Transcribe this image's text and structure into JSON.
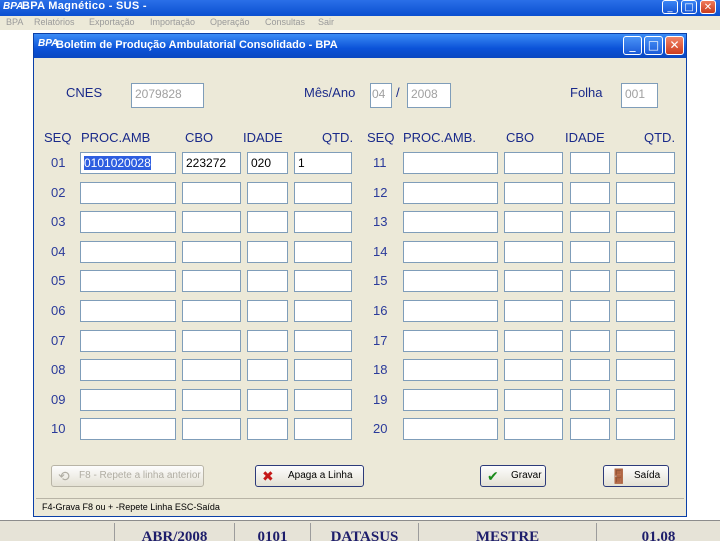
{
  "app": {
    "title": "BPA Magnético - SUS -",
    "logo": "BPA",
    "minimize": "_",
    "maximize": "□",
    "close": "✕"
  },
  "menu": [
    "BPA",
    "Relatórios",
    "Exportação",
    "Importação",
    "Operação",
    "Consultas",
    "Sair"
  ],
  "statusbar": [
    "ABR/2008",
    "0101",
    "DATASUS",
    "MESTRE",
    "01.08"
  ],
  "dialog": {
    "logo": "BPA",
    "title": "Boletim de Produção Ambulatorial Consolidado - BPA",
    "minimize": "_",
    "maximize": "□",
    "close": "✕",
    "cnes_label": "CNES",
    "cnes_value": "2079828",
    "mesano_label": "Mês/Ano",
    "mes_value": "04",
    "separator": "/",
    "ano_value": "2008",
    "folha_label": "Folha",
    "folha_value": "001",
    "headers_left": [
      "SEQ",
      "PROC.AMB",
      "CBO",
      "IDADE",
      "QTD."
    ],
    "headers_right": [
      "SEQ",
      "PROC.AMB.",
      "CBO",
      "IDADE",
      "QTD."
    ],
    "rows_left": [
      {
        "seq": "01",
        "proc": "0101020028",
        "cbo": "223272",
        "idade": "020",
        "qtd": "1"
      },
      {
        "seq": "02",
        "proc": "",
        "cbo": "",
        "idade": "",
        "qtd": ""
      },
      {
        "seq": "03",
        "proc": "",
        "cbo": "",
        "idade": "",
        "qtd": ""
      },
      {
        "seq": "04",
        "proc": "",
        "cbo": "",
        "idade": "",
        "qtd": ""
      },
      {
        "seq": "05",
        "proc": "",
        "cbo": "",
        "idade": "",
        "qtd": ""
      },
      {
        "seq": "06",
        "proc": "",
        "cbo": "",
        "idade": "",
        "qtd": ""
      },
      {
        "seq": "07",
        "proc": "",
        "cbo": "",
        "idade": "",
        "qtd": ""
      },
      {
        "seq": "08",
        "proc": "",
        "cbo": "",
        "idade": "",
        "qtd": ""
      },
      {
        "seq": "09",
        "proc": "",
        "cbo": "",
        "idade": "",
        "qtd": ""
      },
      {
        "seq": "10",
        "proc": "",
        "cbo": "",
        "idade": "",
        "qtd": ""
      }
    ],
    "rows_right": [
      {
        "seq": "11"
      },
      {
        "seq": "12"
      },
      {
        "seq": "13"
      },
      {
        "seq": "14"
      },
      {
        "seq": "15"
      },
      {
        "seq": "16"
      },
      {
        "seq": "17"
      },
      {
        "seq": "18"
      },
      {
        "seq": "19"
      },
      {
        "seq": "20"
      }
    ],
    "buttons": {
      "repeat_label": "F8 - Repete a linha anterior",
      "delete_label": "Apaga a Linha",
      "save_label": "Gravar",
      "exit_label": "Saída"
    },
    "hint": "F4-Grava  F8 ou + -Repete Linha  ESC-Saída"
  },
  "colors": {
    "titlebar": "#0a52d8",
    "label": "#1a2a8a",
    "selection": "#2e5ee0"
  }
}
